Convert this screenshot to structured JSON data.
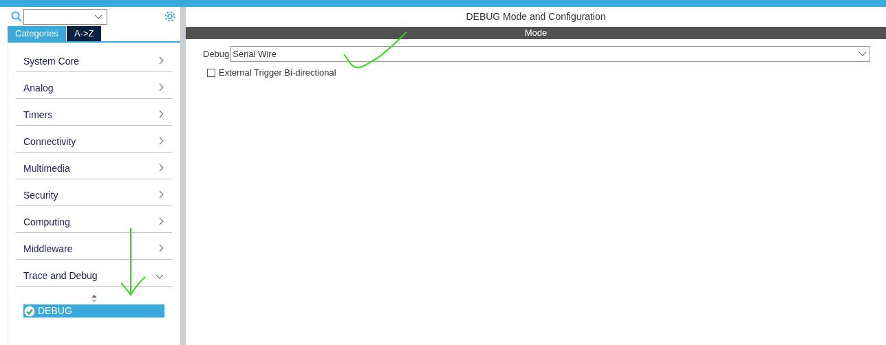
{
  "sidebar": {
    "tabs": [
      {
        "label": "Categories",
        "selected": true
      },
      {
        "label": "A->Z",
        "selected": false
      }
    ],
    "categories": [
      {
        "label": "System Core",
        "expanded": false
      },
      {
        "label": "Analog",
        "expanded": false
      },
      {
        "label": "Timers",
        "expanded": false
      },
      {
        "label": "Connectivity",
        "expanded": false
      },
      {
        "label": "Multimedia",
        "expanded": false
      },
      {
        "label": "Security",
        "expanded": false
      },
      {
        "label": "Computing",
        "expanded": false
      },
      {
        "label": "Middleware",
        "expanded": false
      },
      {
        "label": "Trace and Debug",
        "expanded": true,
        "children": [
          {
            "label": "DEBUG",
            "selected": true,
            "enabled": true
          }
        ]
      }
    ]
  },
  "panel": {
    "title": "DEBUG Mode and Configuration",
    "section": "Mode",
    "fields": [
      {
        "kind": "select",
        "label": "Debug",
        "value": "Serial Wire"
      },
      {
        "kind": "checkbox",
        "label": "External Trigger Bi-directional",
        "checked": false
      }
    ]
  }
}
